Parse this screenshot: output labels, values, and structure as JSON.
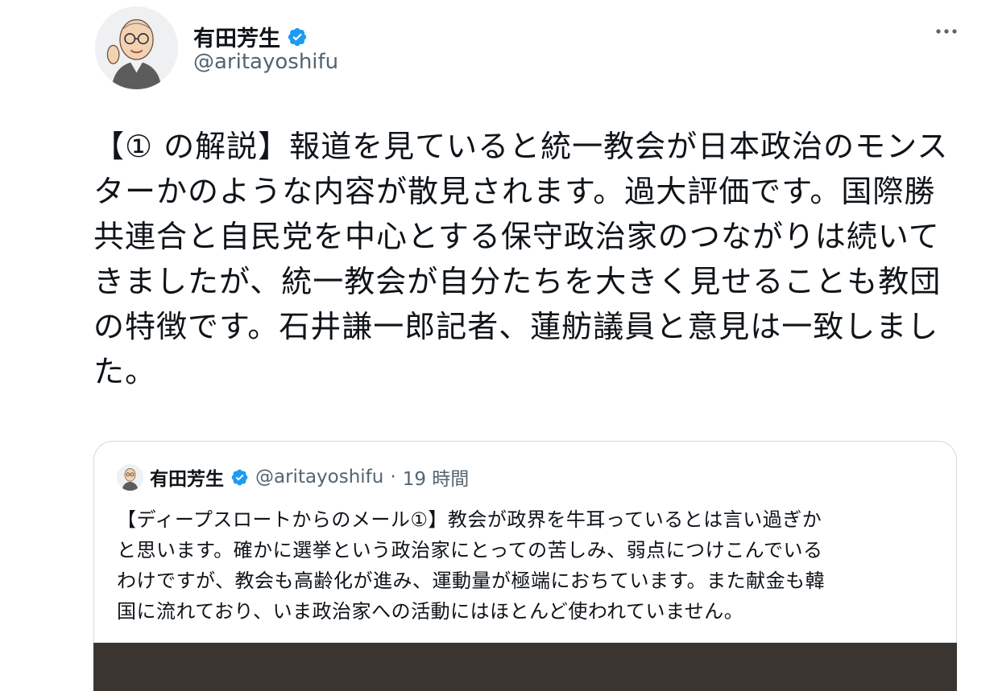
{
  "author": {
    "display_name": "有田芳生",
    "handle": "@aritayoshifu",
    "verified_icon": "verified-badge-icon",
    "avatar": "avatar-illustration"
  },
  "tweet": {
    "text": "【① の解説】報道を見ていると統一教会が日本政治のモンス\nターかのような内容が散見されます。過大評価です。国際勝\n共連合と自民党を中心とする保守政治家のつながりは続いて\nきましたが、統一教会が自分たちを大きく見せることも教団\nの特徴です。石井謙一郎記者、蓮舫議員と意見は一致しまし\nた。"
  },
  "quoted_tweet": {
    "display_name": "有田芳生",
    "handle": "@aritayoshifu",
    "separator": "·",
    "time": "19 時間",
    "text": "【ディープスロートからのメール①】教会が政界を牛耳っているとは言い過ぎか\nと思います。確かに選挙という政治家にとっての苦しみ、弱点につけこんでいる\nわけですが、教会も高齢化が進み、運動量が極端におちています。また献金も韓\n国に流れており、いま政治家への活動にはほとんど使われていません。"
  },
  "icons": {
    "more": "more-options-icon"
  },
  "colors": {
    "verified_blue": "#1d9bf0",
    "secondary_text": "#536471",
    "border": "#cfd9de",
    "primary_text": "#0f1419"
  }
}
